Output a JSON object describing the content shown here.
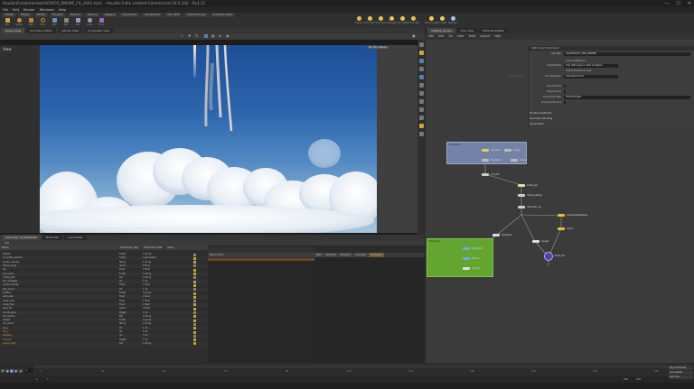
{
  "window": {
    "title": "HoudiniFundamentals\\H20\\FX_SMOKE_FX_v001.hiplc - Houdini Indie Limited-Commercial 20.5.332 - Py3.11",
    "min": "—",
    "max": "☐",
    "close": "✕"
  },
  "menu": [
    "File",
    "Edit",
    "Render",
    "Windows",
    "Help"
  ],
  "shelf_tabs": [
    "Create",
    "Modify",
    "Model",
    "Polygon",
    "Deform",
    "Texture",
    "Rigging",
    "Characters",
    "Constraints",
    "Hair Utils",
    "Guide Process",
    "Guide Brushes",
    "Terrain FX",
    "Simple FX",
    "Volume"
  ],
  "shelf_tools": [
    "Box",
    "Sphere",
    "Tube",
    "Torus",
    "Grid",
    "Null",
    "Line",
    "Circle",
    "Curve",
    "Draw Curve",
    "Path",
    "Spray Paint",
    "Font",
    "Platonic",
    "L-System",
    "Metaball",
    "File"
  ],
  "shelf2_tools": [
    "Camera",
    "Point Light",
    "Spot Light",
    "Area Light",
    "Geo Light",
    "Volume Light",
    "Distant Light",
    "Env Light",
    "Sky Light",
    "GI Light",
    "Caustic Light",
    "Portal Light",
    "Ambient Light",
    "Stereo Cam"
  ],
  "pane_tabs": [
    "Scene View",
    "Animation Editor",
    "Render View",
    "Composite View",
    "Motion FX View",
    "Geometry Spreadsheet"
  ],
  "viewport": {
    "label": "View",
    "camera": "No cam ▾  Persp ▾",
    "info": "Left mouse tumbles. Middle pans. Right dollies. Ctrl+Alt+Left/Middle/Right to zoom. Alt+Left/Middle/Right to tumble/pan/dolly. Space+N switches to view tool."
  },
  "spreadsheet": {
    "tabs": [
      "Geometry Spreadsheet",
      "Node Info",
      "Log Viewer"
    ],
    "node_path": "/obj",
    "columns": [
      "Name",
      "Parameter Type",
      "Parameter Data",
      "Value"
    ],
    "rows": [
      [
        "globals",
        "Folder",
        "4 group",
        ""
      ],
      [
        "fx_render_params",
        "Folder",
        "2 parameter",
        ""
      ],
      [
        "render_camera",
        "String",
        "1 string",
        ""
      ],
      [
        "frame_range",
        "Vector",
        "2 float",
        ""
      ],
      [
        "fps",
        "Float",
        "1 float",
        ""
      ],
      [
        "sim_cache",
        "Folder",
        "1 string",
        ""
      ],
      [
        "cache_path",
        "File",
        "1 string",
        ""
      ],
      [
        "sim_substeps",
        "Int",
        "1 int",
        ""
      ],
      [
        "smoke_density",
        "Float",
        "1 float",
        ""
      ],
      [
        "trail_count",
        "Int",
        "1 int",
        ""
      ],
      [
        "emitter",
        "Folder",
        "3 group",
        ""
      ],
      [
        "emit_rate",
        "Float",
        "1 float",
        ""
      ],
      [
        "noise_amp",
        "Float",
        "1 float",
        ""
      ],
      [
        "noise_freq",
        "Float",
        "1 float",
        ""
      ],
      [
        "wind_dir",
        "Vector",
        "3 float",
        ""
      ],
      [
        "clouds_layer",
        "Toggle",
        "1 int",
        ""
      ],
      [
        "sky_texture",
        "File",
        "1 string",
        ""
      ],
      [
        "output",
        "Folder",
        "2 group",
        ""
      ],
      [
        "out_driver",
        "String",
        "1 string",
        ""
      ],
      [
        "res_x",
        "Int",
        "1 int",
        ""
      ],
      [
        "res_y",
        "Int",
        "1 int",
        ""
      ],
      [
        "samples",
        "Int",
        "1 int",
        ""
      ],
      [
        "denoise",
        "Toggle",
        "1 int",
        ""
      ],
      [
        "export_path",
        "File",
        "1 string",
        ""
      ]
    ]
  },
  "parm_panel": {
    "header": "Name  Value",
    "tabs": [
      "Main",
      "Attribute",
      "Transform",
      "Local Vars",
      "Expression"
    ]
  },
  "network": {
    "tabs": [
      "/obj/fire_smoke",
      "Tree View",
      "Material Palette"
    ],
    "menu": [
      "Add",
      "Edit",
      "Go",
      "View",
      "Tools",
      "Layout",
      "Help"
    ],
    "context": "Solaris",
    "node_header": "SOP Import  fireimport",
    "parms": [
      {
        "label": "SOP Path",
        "value": "/obj/FIRE/OUT_FIRE_RENDER"
      },
      {
        "label": "",
        "value": "Load as Reference"
      },
      {
        "label": "Subset Mode",
        "value": "Only USD Layer no Man Configure"
      },
      {
        "label": "",
        "value": "Import Primitive to Sopt"
      },
      {
        "label": "Prim Definition",
        "value": "Use Default Prim"
      },
      {
        "label": "Import Frame",
        "value": ""
      },
      {
        "label": "Import Group",
        "value": ""
      },
      {
        "label": "Import Prim Path",
        "value": "/FireFx/FireNet"
      },
      {
        "label": "Override Primvars",
        "value": ""
      }
    ],
    "sections": [
      "Primitive Definition",
      "Geometry Handling",
      "Import Data"
    ],
    "nodes": {
      "blue_box_title": "Smoke Sim",
      "green_box_title": "Fire Render",
      "labels": [
        "sopimport",
        "merge1",
        "fire_import",
        "volume",
        "null_OUT",
        "smoke_sim",
        "render_settings",
        "usdrender_rop",
        "karmarendersettings",
        "karma"
      ]
    }
  },
  "timeline": {
    "frame": "1",
    "ticks": [
      "1",
      "24",
      "48",
      "72",
      "96",
      "120",
      "144",
      "168",
      "192",
      "216",
      "240"
    ],
    "start": "1",
    "end": "240",
    "range_start": "1",
    "range_end": "240",
    "auto_update": "Auto Update",
    "keys": "Key All Channels",
    "realtime": "Real Time"
  }
}
